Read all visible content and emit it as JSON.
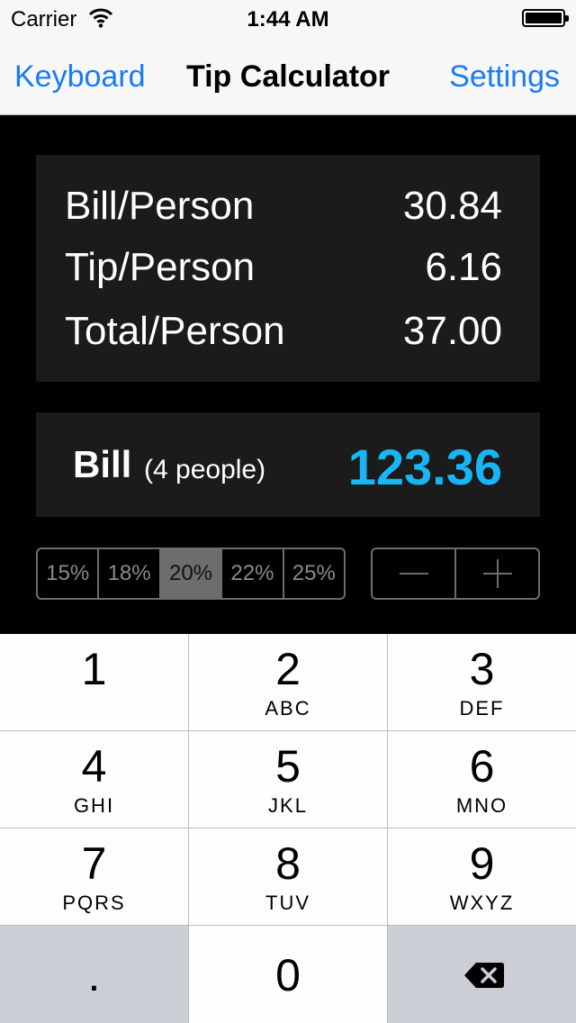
{
  "status_bar": {
    "carrier": "Carrier",
    "time": "1:44 AM"
  },
  "nav": {
    "left": "Keyboard",
    "title": "Tip Calculator",
    "right": "Settings"
  },
  "results": {
    "bill_label": "Bill/Person",
    "bill_value": "30.84",
    "tip_label": "Tip/Person",
    "tip_value": "6.16",
    "total_label": "Total/Person",
    "total_value": "37.00"
  },
  "bill": {
    "label": "Bill",
    "people": "(4 people)",
    "value": "123.36"
  },
  "tip_options": [
    "15%",
    "18%",
    "20%",
    "22%",
    "25%"
  ],
  "selected_tip": "20%",
  "keypad": {
    "keys": [
      {
        "digit": "1",
        "letters": ""
      },
      {
        "digit": "2",
        "letters": "ABC"
      },
      {
        "digit": "3",
        "letters": "DEF"
      },
      {
        "digit": "4",
        "letters": "GHI"
      },
      {
        "digit": "5",
        "letters": "JKL"
      },
      {
        "digit": "6",
        "letters": "MNO"
      },
      {
        "digit": "7",
        "letters": "PQRS"
      },
      {
        "digit": "8",
        "letters": "TUV"
      },
      {
        "digit": "9",
        "letters": "WXYZ"
      }
    ],
    "decimal": ".",
    "zero": "0"
  },
  "colors": {
    "accent": "#1a7cf2",
    "bill_value": "#18b6f6",
    "panel": "#1b1b1b"
  }
}
